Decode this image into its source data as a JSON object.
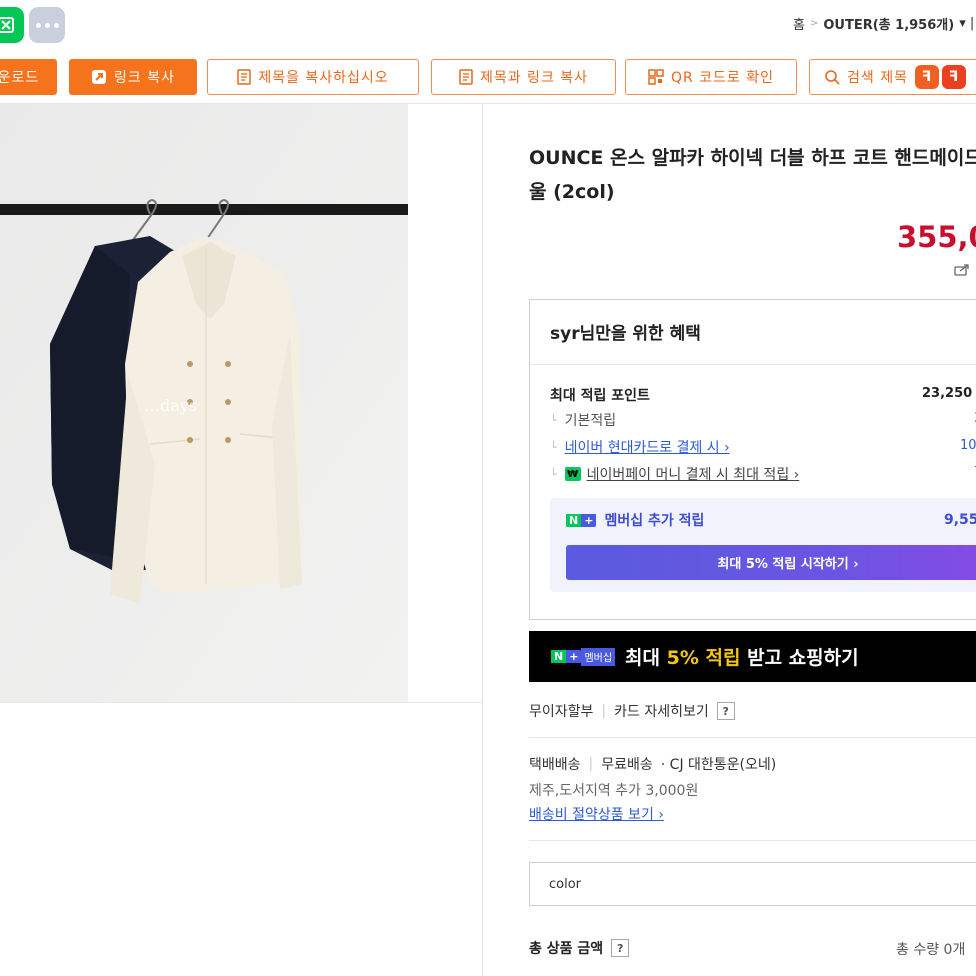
{
  "top": {
    "breadcrumb": {
      "home": "홈",
      "category": "OUTER(총 1,956개)",
      "extra": "▾ |"
    }
  },
  "toolbar": {
    "download_label": "운로드",
    "link_copy_label": "링크 복사",
    "title_copy_label": "제목을 복사하십시오",
    "title_link_copy_label": "제목과 링크 복사",
    "qr_label": "QR 코드로 확인",
    "search_label": "검색 제목"
  },
  "product": {
    "image_watermark": "…days",
    "title": "OUNCE 온스 알파카 하이넥 더블 하프 코트 핸드메이드 울 (2col)",
    "price": "355,0"
  },
  "benefits": {
    "title": "syr님만을 위한 혜택",
    "rows": [
      {
        "label": "최대 적립 포인트",
        "value": "23,250"
      },
      {
        "label": "기본적립",
        "value": "3,"
      },
      {
        "label": "네이버 현대카드로 결제 시 ›",
        "value": "10,"
      },
      {
        "label": "네이버페이 머니 결제 시 최대 적립 ›",
        "value": "7,"
      }
    ],
    "membership": {
      "badge_n": "N",
      "badge_plus": "+",
      "label": "멤버십 추가 적립",
      "value": "9,55",
      "button_label": "최대 5% 적립 시작하기 ›"
    }
  },
  "banner": {
    "badge_n": "N",
    "badge_plus": "+",
    "badge_tag": "멤버십",
    "text_before": "최대 ",
    "text_highlight": "5% 적립",
    "text_after": " 받고 쇼핑하기"
  },
  "payment": {
    "installment": "무이자할부",
    "card_details": "카드 자세히보기",
    "help_mark": "?"
  },
  "shipping": {
    "method": "택배배송",
    "fee": "무료배송",
    "carrier": "· CJ 대한통운(오네)",
    "extra_fee_note": "제주,도서지역 추가 3,000원",
    "saver_link": "배송비 절약상품 보기 ›"
  },
  "options": {
    "color_select_value": "color"
  },
  "summary": {
    "total_label": "총 상품 금액",
    "help_mark": "?",
    "quantity_text": "총 수량 0개"
  },
  "colors": {
    "accent_orange": "#f4731c",
    "price_red": "#c8102e",
    "naver_green": "#03c75a",
    "membership_purple": "#5b5bdf",
    "link_blue": "#2d5bd4"
  }
}
